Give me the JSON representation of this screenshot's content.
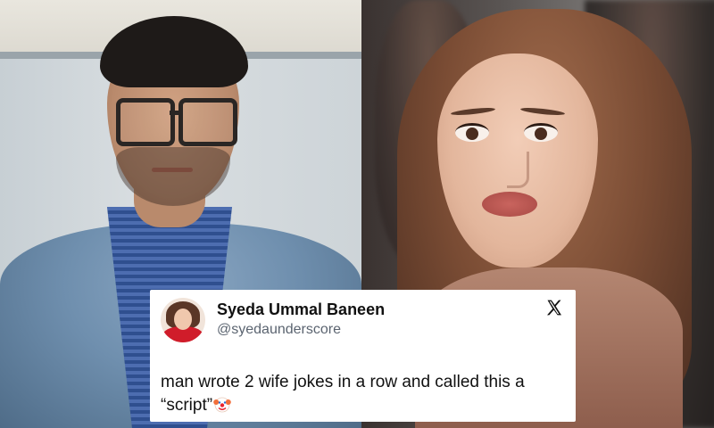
{
  "tweet": {
    "display_name": "Syeda Ummal Baneen",
    "handle": "@syedaunderscore",
    "text_line1": "man wrote 2 wife jokes in a row and called this a",
    "text_line2": "“script”",
    "emoji": "clown-face"
  },
  "icons": {
    "platform": "x-logo",
    "avatar": "avatar"
  }
}
